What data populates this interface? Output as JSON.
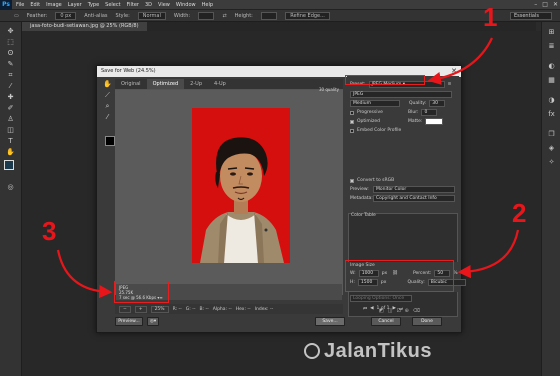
{
  "app": {
    "logo": "Ps",
    "menu": [
      "File",
      "Edit",
      "Image",
      "Layer",
      "Type",
      "Select",
      "Filter",
      "3D",
      "View",
      "Window",
      "Help"
    ],
    "window_controls": [
      "–",
      "□",
      "✕"
    ]
  },
  "options_bar": {
    "feather_label": "Feather:",
    "feather_value": "0 px",
    "antialias_label": "Anti-alias",
    "style_label": "Style:",
    "style_value": "Normal",
    "width_label": "Width:",
    "height_label": "Height:",
    "refine_edge": "Refine Edge...",
    "workspace": "Essentials"
  },
  "document_tab": "jasa-foto-budi-setiawan.jpg @ 25% (RGB/8)",
  "dialog": {
    "title": "Save for Web (24.5%)",
    "close": "✕",
    "tabs": [
      "Original",
      "Optimized",
      "2-Up",
      "4-Up"
    ],
    "active_tab": "Optimized",
    "preview_info": {
      "format": "JPEG",
      "size": "25.75K",
      "time": "7 sec @ 56.6 Kbps",
      "quality": "30 quality",
      "menu": "▾≡"
    },
    "zoom": "25%",
    "zoom_bar": {
      "r": "R: --",
      "g": "G: --",
      "b": "B: --",
      "alpha": "Alpha: --",
      "hex": "Hex: --",
      "index": "Index: --"
    },
    "preset": {
      "label": "Preset:",
      "value": "JPEG Medium"
    },
    "format": "JPEG",
    "compression": "Medium",
    "quality_label": "Quality:",
    "quality_value": "30",
    "progressive_label": "Progressive",
    "blur_label": "Blur:",
    "blur_value": "0",
    "optimized_label": "Optimized",
    "matte_label": "Matte:",
    "embed_profile_label": "Embed Color Profile",
    "convert_srgb_label": "Convert to sRGB",
    "preview_label": "Preview:",
    "preview_value": "Monitor Color",
    "metadata_label": "Metadata:",
    "metadata_value": "Copyright and Contact Info",
    "color_table_label": "Color Table",
    "image_size": {
      "label": "Image Size",
      "w_label": "W:",
      "w_value": "1000",
      "h_label": "H:",
      "h_value": "1500",
      "unit": "px",
      "percent_label": "Percent:",
      "percent_value": "50",
      "percent_unit": "%",
      "quality_label": "Quality:",
      "quality_value": "Bicubic"
    },
    "animation_label": "Looping Options: Once",
    "frames": "1 of 1",
    "buttons": {
      "preview": "Preview...",
      "save": "Save...",
      "cancel": "Cancel",
      "done": "Done"
    }
  },
  "callouts": [
    "1",
    "2",
    "3"
  ],
  "watermark": "JalanTikus",
  "colors": {
    "callout": "#e8161b",
    "photo_background": "#d50e0e",
    "ps_blue": "#31a8ff"
  }
}
